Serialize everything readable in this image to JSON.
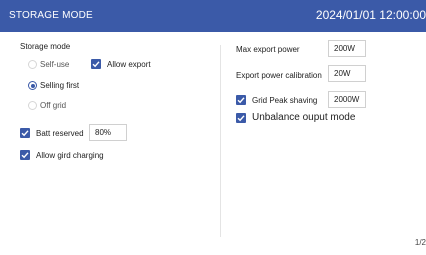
{
  "header": {
    "title": "STORAGE MODE",
    "datetime": "2024/01/01 12:00:00"
  },
  "left": {
    "storage_mode_label": "Storage mode",
    "modes": [
      {
        "label": "Self-use",
        "selected": false
      },
      {
        "label": "Selling first",
        "selected": true
      },
      {
        "label": "Off grid",
        "selected": false
      }
    ],
    "allow_export": {
      "label": "Allow export",
      "checked": true
    },
    "batt_reserved": {
      "label": "Batt reserved",
      "checked": true,
      "value": "80%"
    },
    "allow_grid_charging": {
      "label": "Allow gird charging",
      "checked": true
    }
  },
  "right": {
    "max_export_power": {
      "label": "Max export power",
      "value": "200W"
    },
    "export_power_calibration": {
      "label": "Export power calibration",
      "value": "20W"
    },
    "grid_peak_shaving": {
      "label": "Grid Peak shaving",
      "checked": true,
      "value": "2000W"
    },
    "unbalance_output_mode": {
      "label": "Unbalance ouput mode",
      "checked": true
    }
  },
  "footer": {
    "page_indicator": "1/2"
  },
  "colors": {
    "accent": "#3b5aa8",
    "header_bg": "#3b5aa8"
  }
}
